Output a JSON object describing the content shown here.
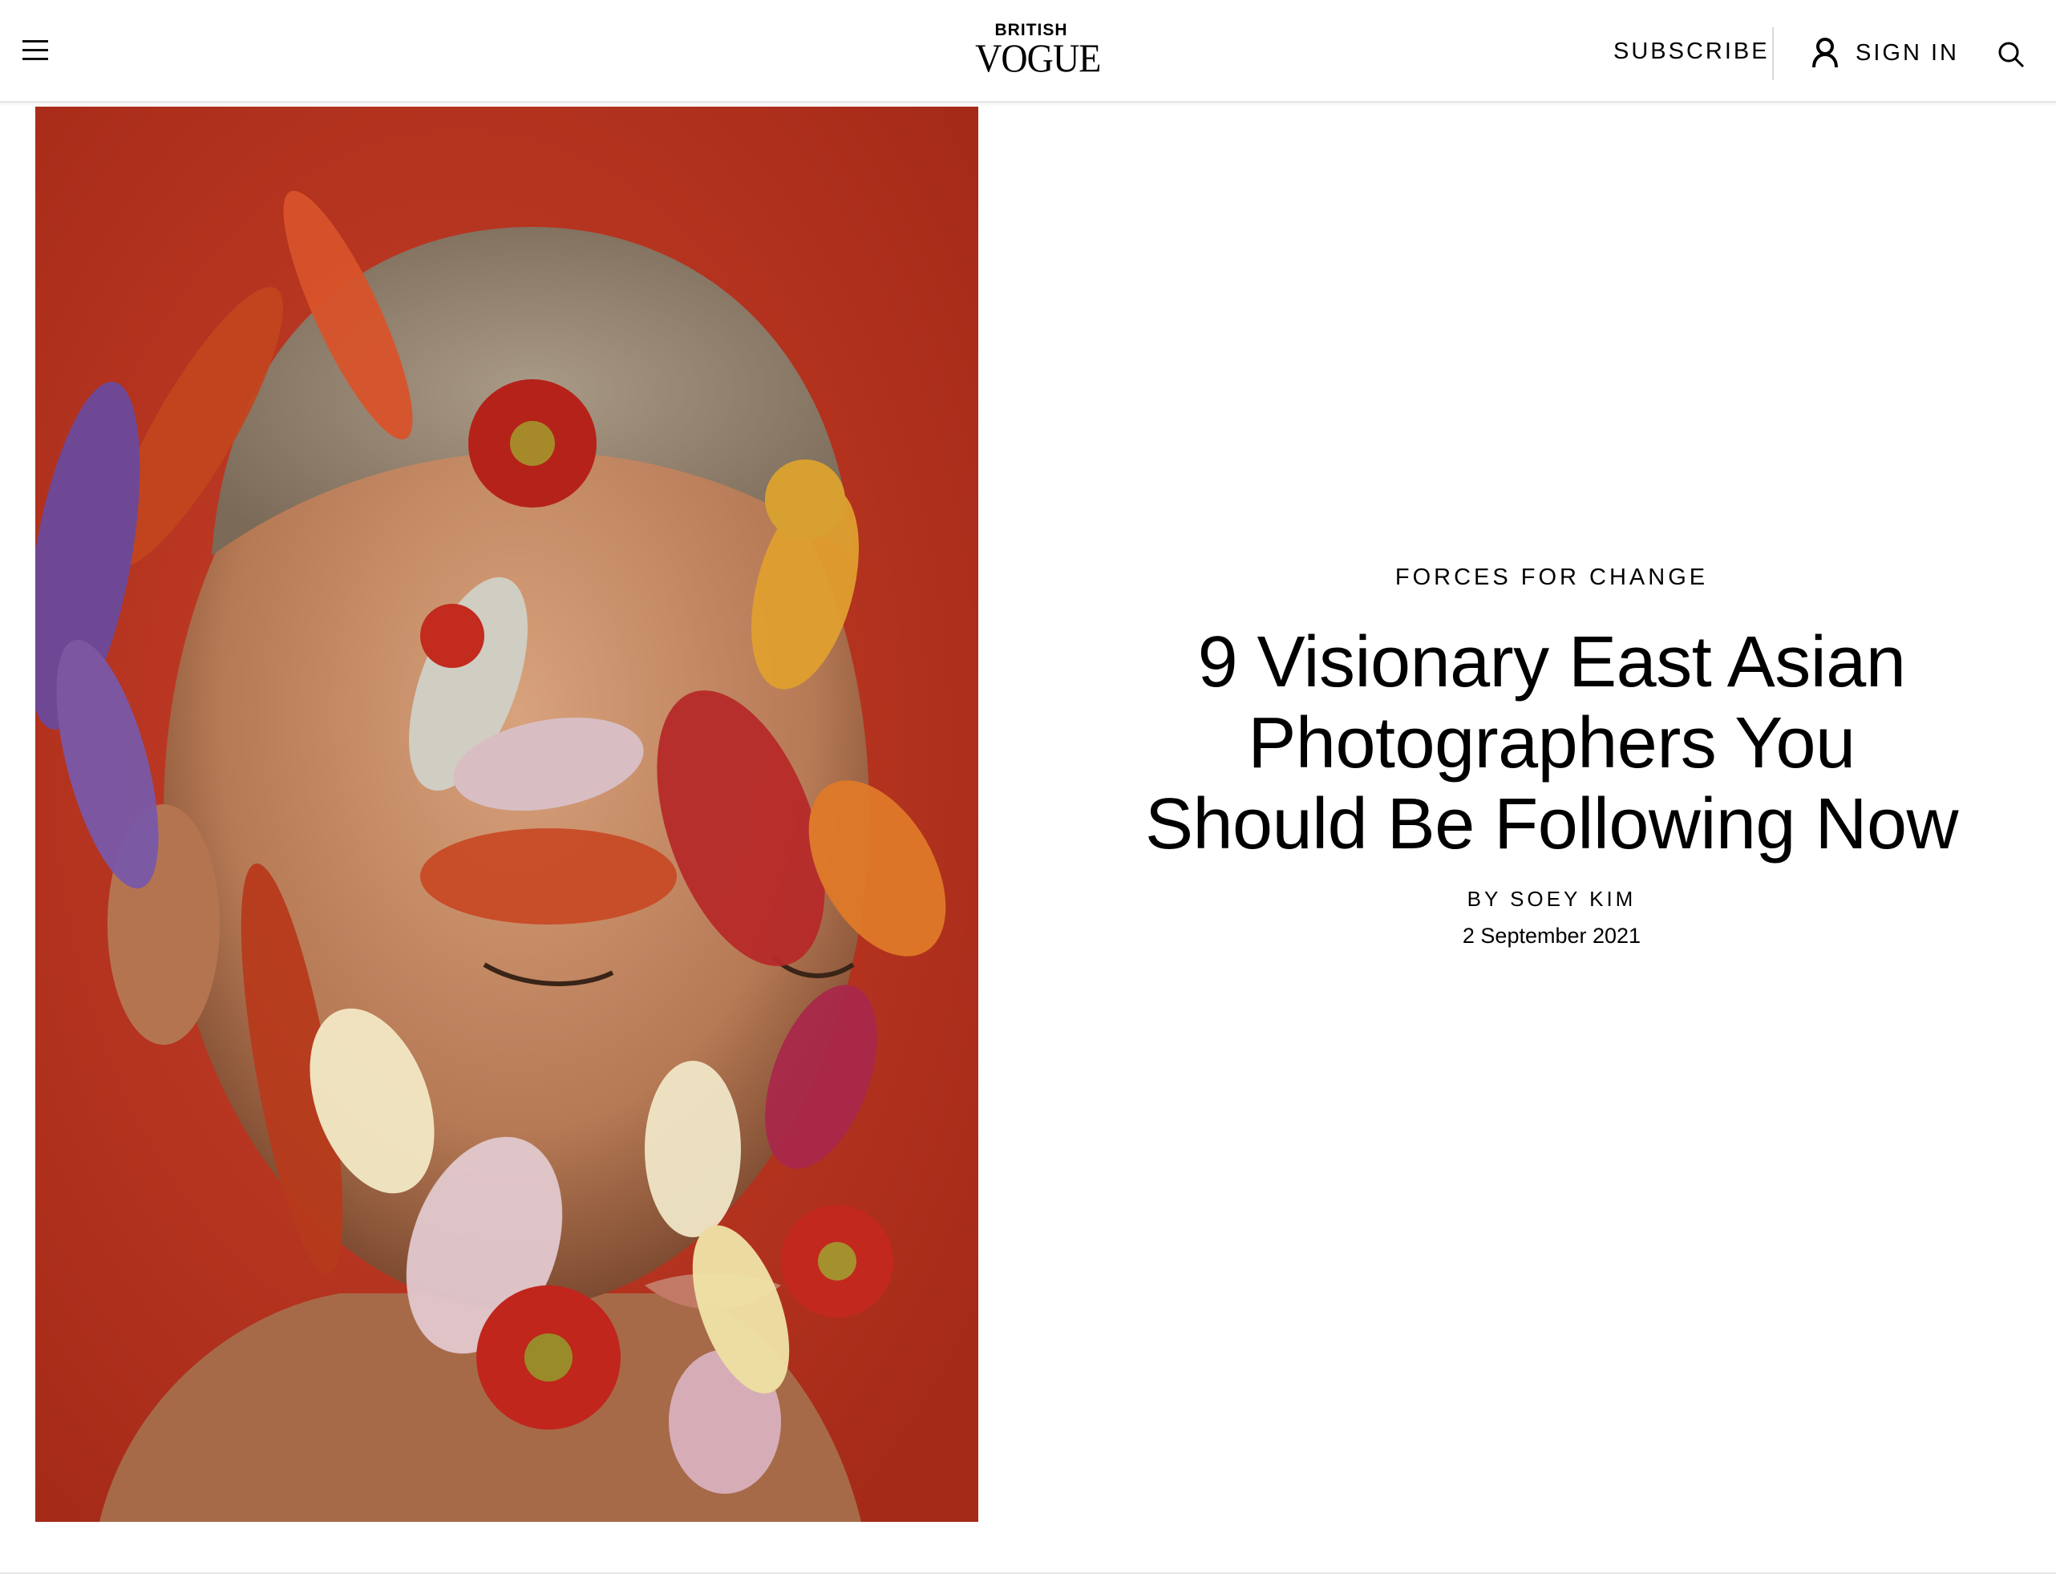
{
  "header": {
    "menu_icon": "hamburger-menu-icon",
    "logo_top": "BRITISH",
    "logo_main": "VOGUE",
    "subscribe_label": "SUBSCRIBE",
    "signin_label": "SIGN IN",
    "user_icon": "user-icon",
    "search_icon": "search-icon"
  },
  "hero": {
    "image_description_icon": "hero-photo",
    "background_color": "#b8321f"
  },
  "article": {
    "rubric": "FORCES FOR CHANGE",
    "headline": "9 Visionary East Asian Photographers You Should Be Following Now",
    "byline_prefix": "BY ",
    "author": "SOEY KIM",
    "date": "2 September 2021"
  }
}
